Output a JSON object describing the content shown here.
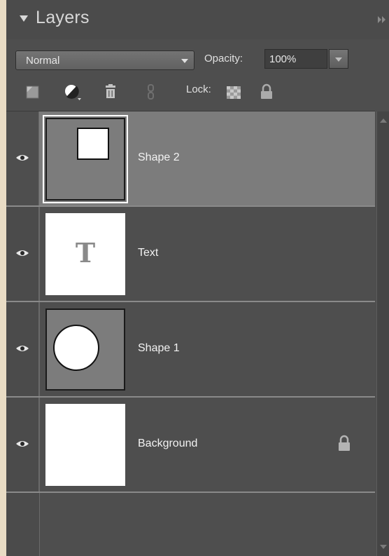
{
  "panel": {
    "title": "Layers"
  },
  "controls": {
    "blend_mode": "Normal",
    "opacity_label": "Opacity:",
    "opacity_value": "100%",
    "lock_label": "Lock:"
  },
  "toolbar": {
    "icons": [
      "new-layer-icon",
      "adjustment-layer-icon",
      "trash-icon",
      "link-icon",
      "lock-transparent-icon",
      "lock-all-icon"
    ]
  },
  "layers": [
    {
      "name": "Shape 2",
      "visible": true,
      "selected": true,
      "locked": false,
      "thumbnail": "square-shape"
    },
    {
      "name": "Text",
      "visible": true,
      "selected": false,
      "locked": false,
      "thumbnail": "text",
      "thumbnail_glyph": "T"
    },
    {
      "name": "Shape 1",
      "visible": true,
      "selected": false,
      "locked": false,
      "thumbnail": "circle-shape"
    },
    {
      "name": "Background",
      "visible": true,
      "selected": false,
      "locked": true,
      "thumbnail": "blank-white"
    }
  ],
  "colors": {
    "panel_bg": "#4e4e4e",
    "selected_row": "#7c7c7c",
    "text": "#f2f2f2",
    "outside_bg": "#e9dcc5"
  }
}
